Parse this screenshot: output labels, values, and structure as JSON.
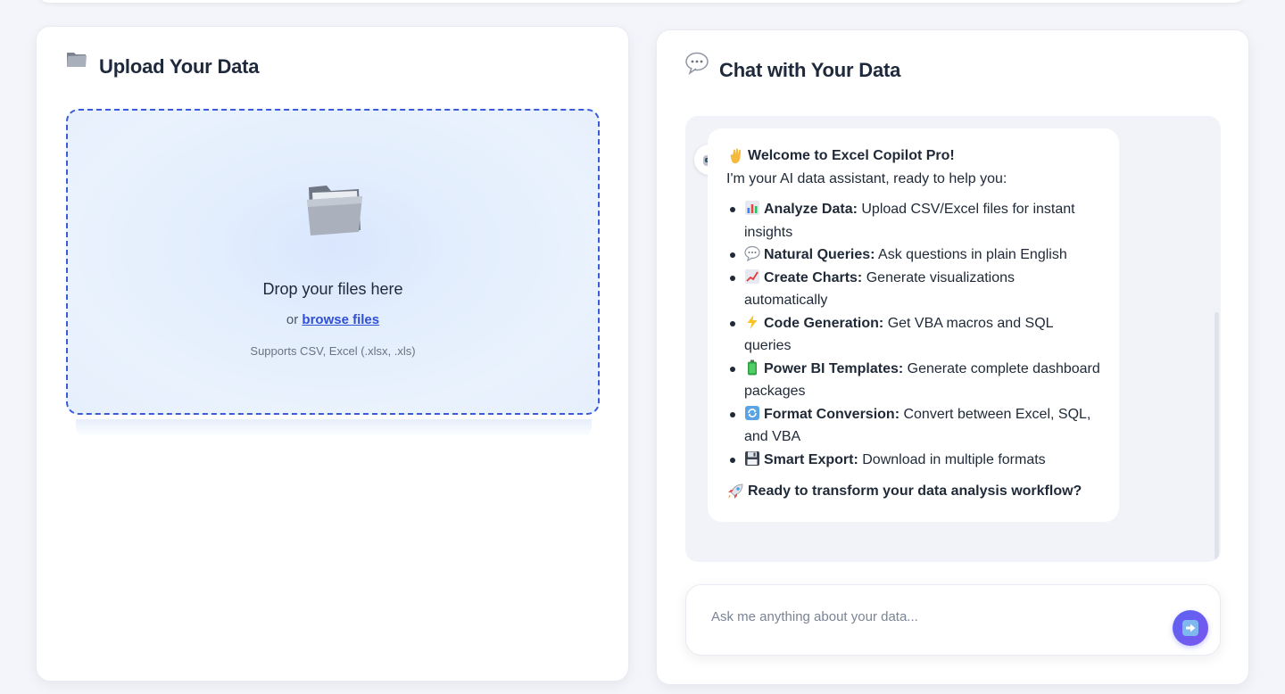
{
  "upload": {
    "title": "Upload Your Data",
    "drop_title": "Drop your files here",
    "or_text": "or",
    "browse_label": "browse files",
    "supports": "Supports CSV, Excel (.xlsx, .xls)",
    "icon": "folder-icon"
  },
  "chat": {
    "title": "Chat with Your Data",
    "icon": "speech-bubble-icon",
    "avatar_icon": "robot-icon",
    "welcome_title": "Welcome to Excel Copilot Pro!",
    "intro": "I'm your AI data assistant, ready to help you:",
    "features": [
      {
        "icon": "bar-chart-icon",
        "name": "Analyze Data:",
        "desc": "Upload CSV/Excel files for instant insights"
      },
      {
        "icon": "speech-bubble-icon",
        "name": "Natural Queries:",
        "desc": "Ask questions in plain English"
      },
      {
        "icon": "line-chart-icon",
        "name": "Create Charts:",
        "desc": "Generate visualizations automatically"
      },
      {
        "icon": "lightning-icon",
        "name": "Code Generation:",
        "desc": "Get VBA macros and SQL queries"
      },
      {
        "icon": "battery-icon",
        "name": "Power BI Templates:",
        "desc": "Generate complete dashboard packages"
      },
      {
        "icon": "refresh-icon",
        "name": "Format Conversion:",
        "desc": "Convert between Excel, SQL, and VBA"
      },
      {
        "icon": "floppy-disk-icon",
        "name": "Smart Export:",
        "desc": "Download in multiple formats"
      }
    ],
    "cta": "Ready to transform your data analysis workflow?",
    "cta_icon": "rocket-icon",
    "input_placeholder": "Ask me anything about your data...",
    "input_value": "",
    "send_icon": "arrow-right-icon"
  },
  "colors": {
    "accent": "#3b5bdb",
    "send_button": "#5b63f2",
    "page_bg": "#f3f5fa"
  }
}
